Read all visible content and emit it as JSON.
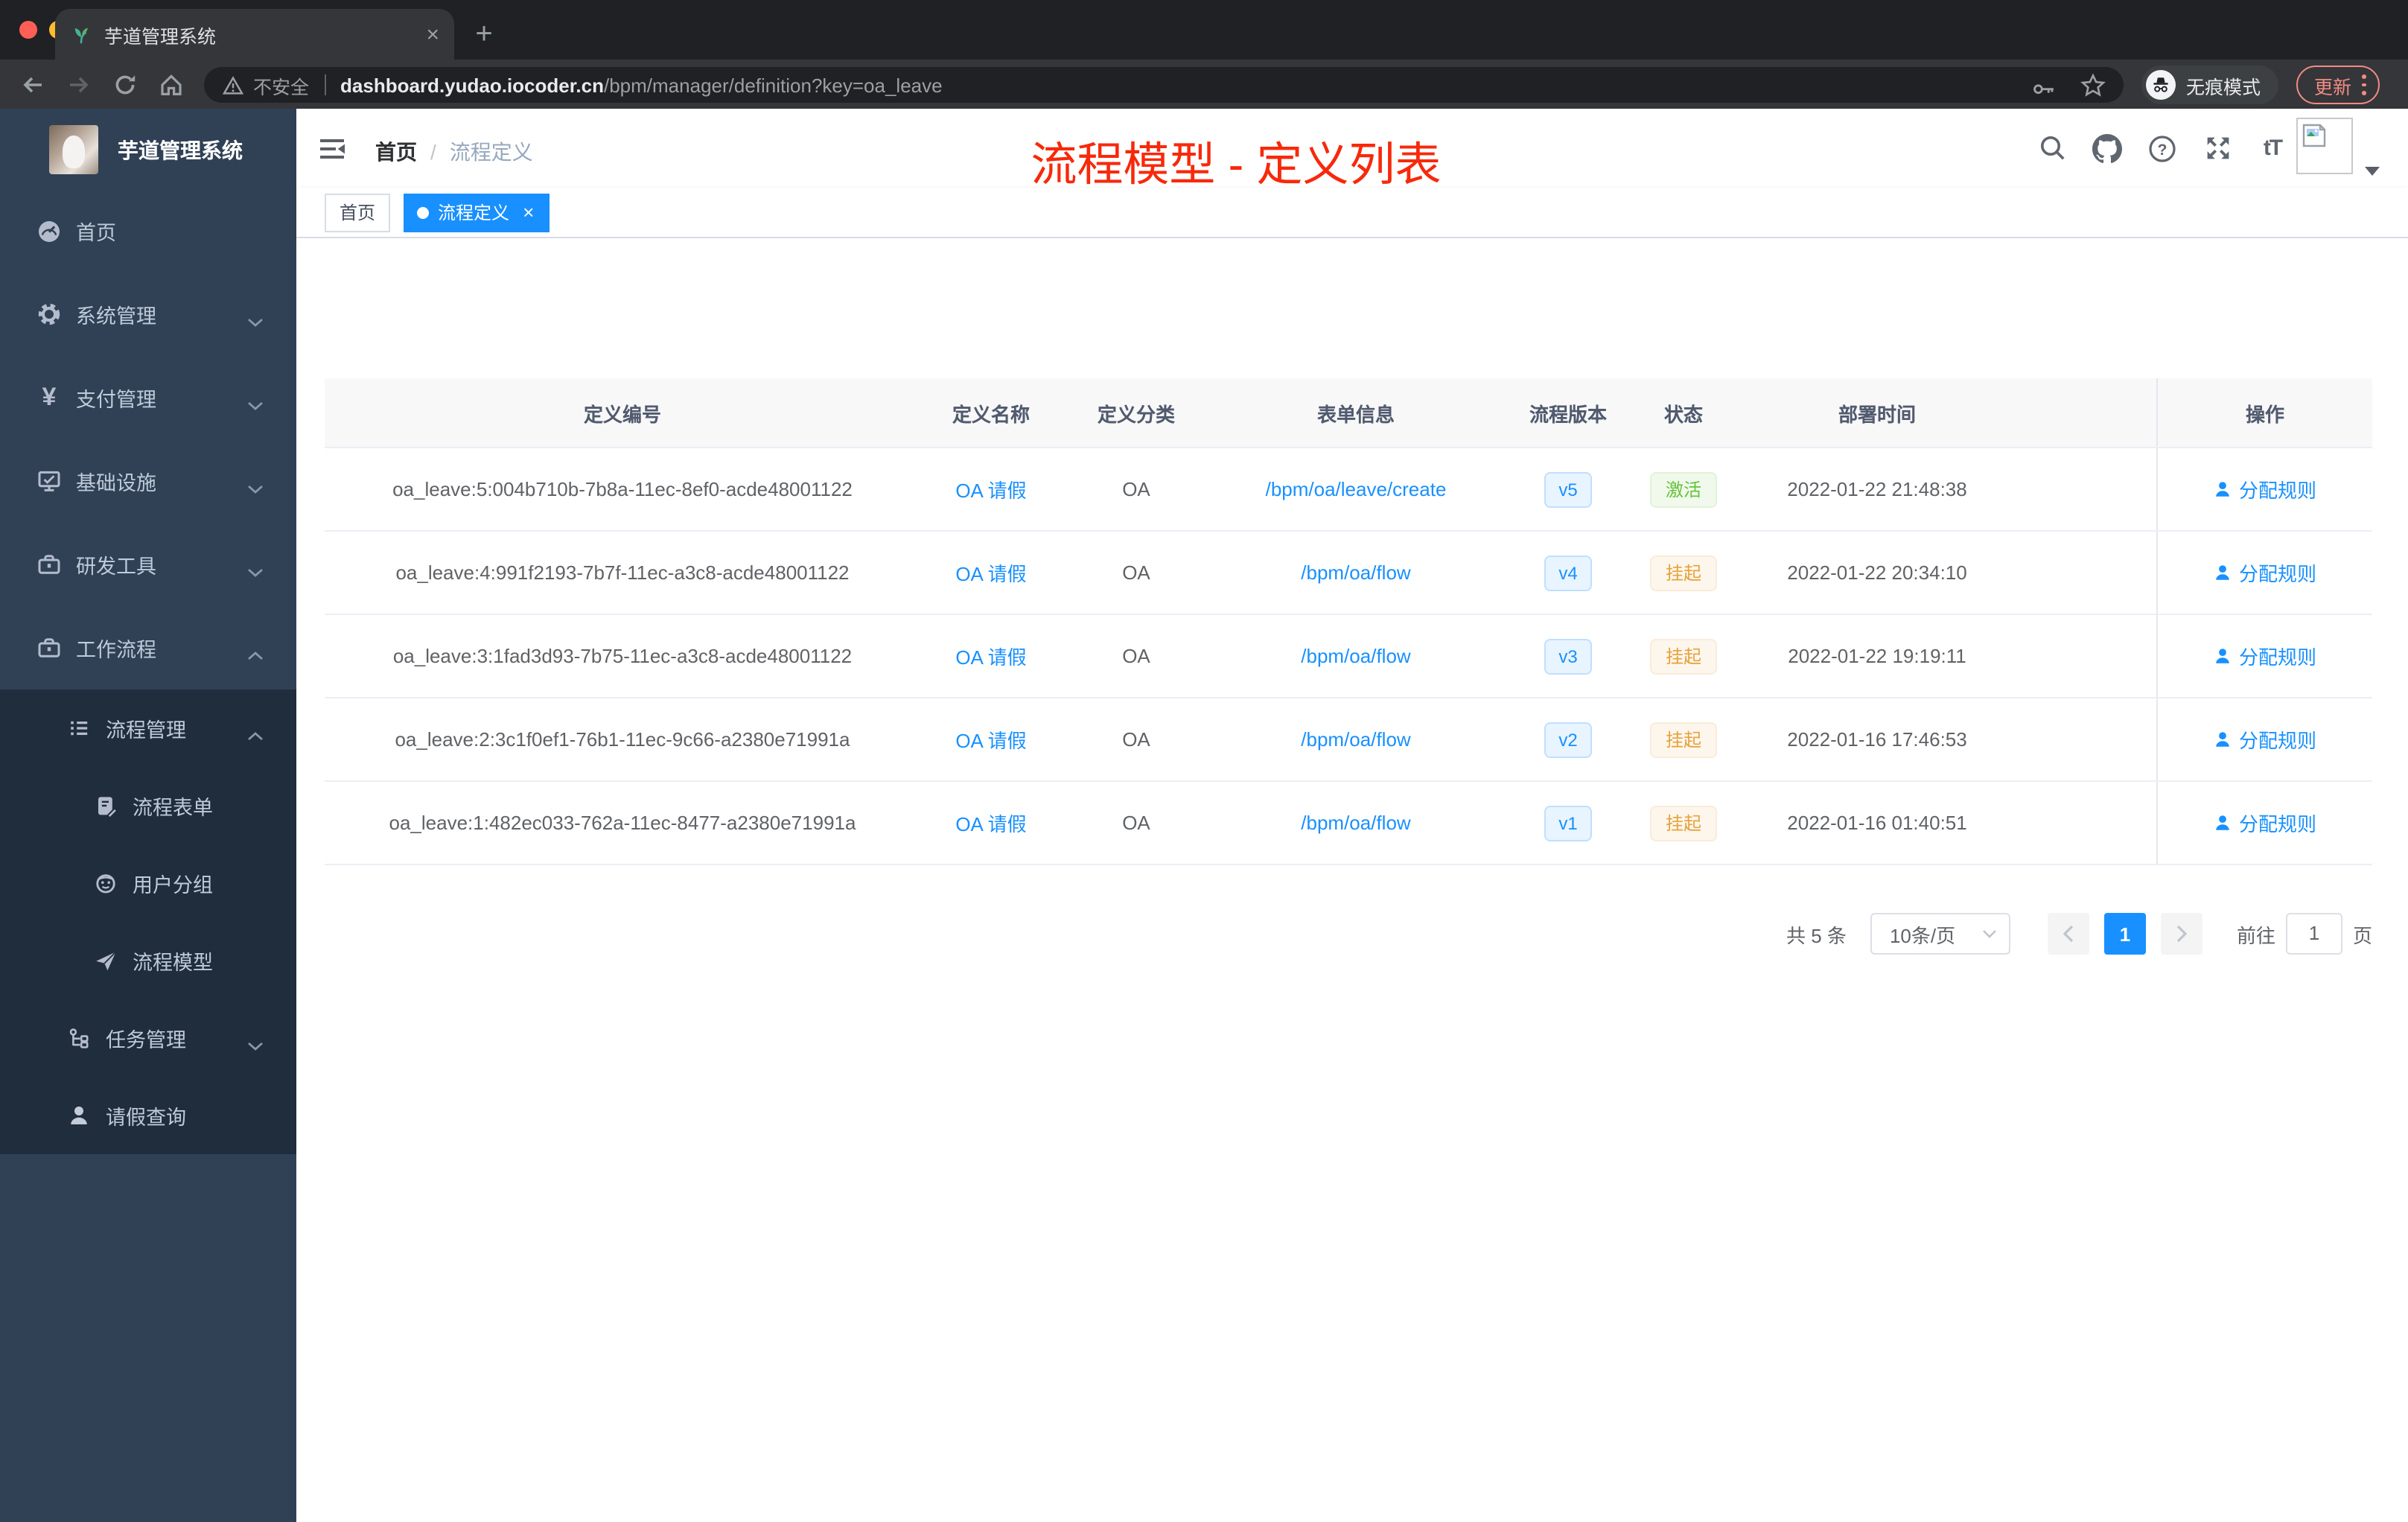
{
  "browser": {
    "tab_title": "芋道管理系统",
    "new_tab_glyph": "+",
    "close_glyph": "×",
    "security_label": "不安全",
    "url_domain": "dashboard.yudao.iocoder.cn",
    "url_path": "/bpm/manager/definition?key=oa_leave",
    "incognito_label": "无痕模式",
    "update_label": "更新"
  },
  "sidebar": {
    "app_title": "芋道管理系统",
    "items": [
      {
        "label": "首页",
        "icon": "dashboard-icon"
      },
      {
        "label": "系统管理",
        "icon": "gear-icon",
        "chevron": "down"
      },
      {
        "label": "支付管理",
        "icon": "yen-icon",
        "chevron": "down"
      },
      {
        "label": "基础设施",
        "icon": "monitor-icon",
        "chevron": "down"
      },
      {
        "label": "研发工具",
        "icon": "toolbox-icon",
        "chevron": "down"
      },
      {
        "label": "工作流程",
        "icon": "toolbox-icon",
        "chevron": "up"
      },
      {
        "label": "流程管理",
        "icon": "list-icon",
        "chevron": "up"
      },
      {
        "label": "流程表单",
        "icon": "form-edit-icon"
      },
      {
        "label": "用户分组",
        "icon": "user-group-icon"
      },
      {
        "label": "流程模型",
        "icon": "paper-plane-icon"
      },
      {
        "label": "任务管理",
        "icon": "org-tree-icon",
        "chevron": "down"
      },
      {
        "label": "请假查询",
        "icon": "person-icon"
      }
    ]
  },
  "navbar": {
    "breadcrumb_home": "首页",
    "breadcrumb_separator": "/",
    "breadcrumb_current": "流程定义"
  },
  "annotation": {
    "text": "流程模型 - 定义列表",
    "color": "#f7290b"
  },
  "tags": {
    "home_label": "首页",
    "active_label": "流程定义",
    "active_close_glyph": "×"
  },
  "table": {
    "columns": [
      "定义编号",
      "定义名称",
      "定义分类",
      "表单信息",
      "流程版本",
      "状态",
      "部署时间",
      "操作"
    ],
    "rows": [
      {
        "id": "oa_leave:5:004b710b-7b8a-11ec-8ef0-acde48001122",
        "name": "OA 请假",
        "category": "OA",
        "form": "/bpm/oa/leave/create",
        "version": "v5",
        "status": "激活",
        "status_type": "success",
        "time": "2022-01-22 21:48:38",
        "action": "分配规则"
      },
      {
        "id": "oa_leave:4:991f2193-7b7f-11ec-a3c8-acde48001122",
        "name": "OA 请假",
        "category": "OA",
        "form": "/bpm/oa/flow",
        "version": "v4",
        "status": "挂起",
        "status_type": "warning",
        "time": "2022-01-22 20:34:10",
        "action": "分配规则"
      },
      {
        "id": "oa_leave:3:1fad3d93-7b75-11ec-a3c8-acde48001122",
        "name": "OA 请假",
        "category": "OA",
        "form": "/bpm/oa/flow",
        "version": "v3",
        "status": "挂起",
        "status_type": "warning",
        "time": "2022-01-22 19:19:11",
        "action": "分配规则"
      },
      {
        "id": "oa_leave:2:3c1f0ef1-76b1-11ec-9c66-a2380e71991a",
        "name": "OA 请假",
        "category": "OA",
        "form": "/bpm/oa/flow",
        "version": "v2",
        "status": "挂起",
        "status_type": "warning",
        "time": "2022-01-16 17:46:53",
        "action": "分配规则"
      },
      {
        "id": "oa_leave:1:482ec033-762a-11ec-8477-a2380e71991a",
        "name": "OA 请假",
        "category": "OA",
        "form": "/bpm/oa/flow",
        "version": "v1",
        "status": "挂起",
        "status_type": "warning",
        "time": "2022-01-16 01:40:51",
        "action": "分配规则"
      }
    ]
  },
  "pagination": {
    "total_label": "共 5 条",
    "page_size_label": "10条/页",
    "current_page": "1",
    "goto_label": "前往",
    "goto_page": "1",
    "unit_label": "页"
  },
  "colors": {
    "accent": "#1890ff",
    "success": "#67c23a",
    "warning": "#e6a23c",
    "annotation_red": "#f7290b",
    "sidebar_bg": "#304156",
    "submenu_bg": "#1f2d3d"
  }
}
